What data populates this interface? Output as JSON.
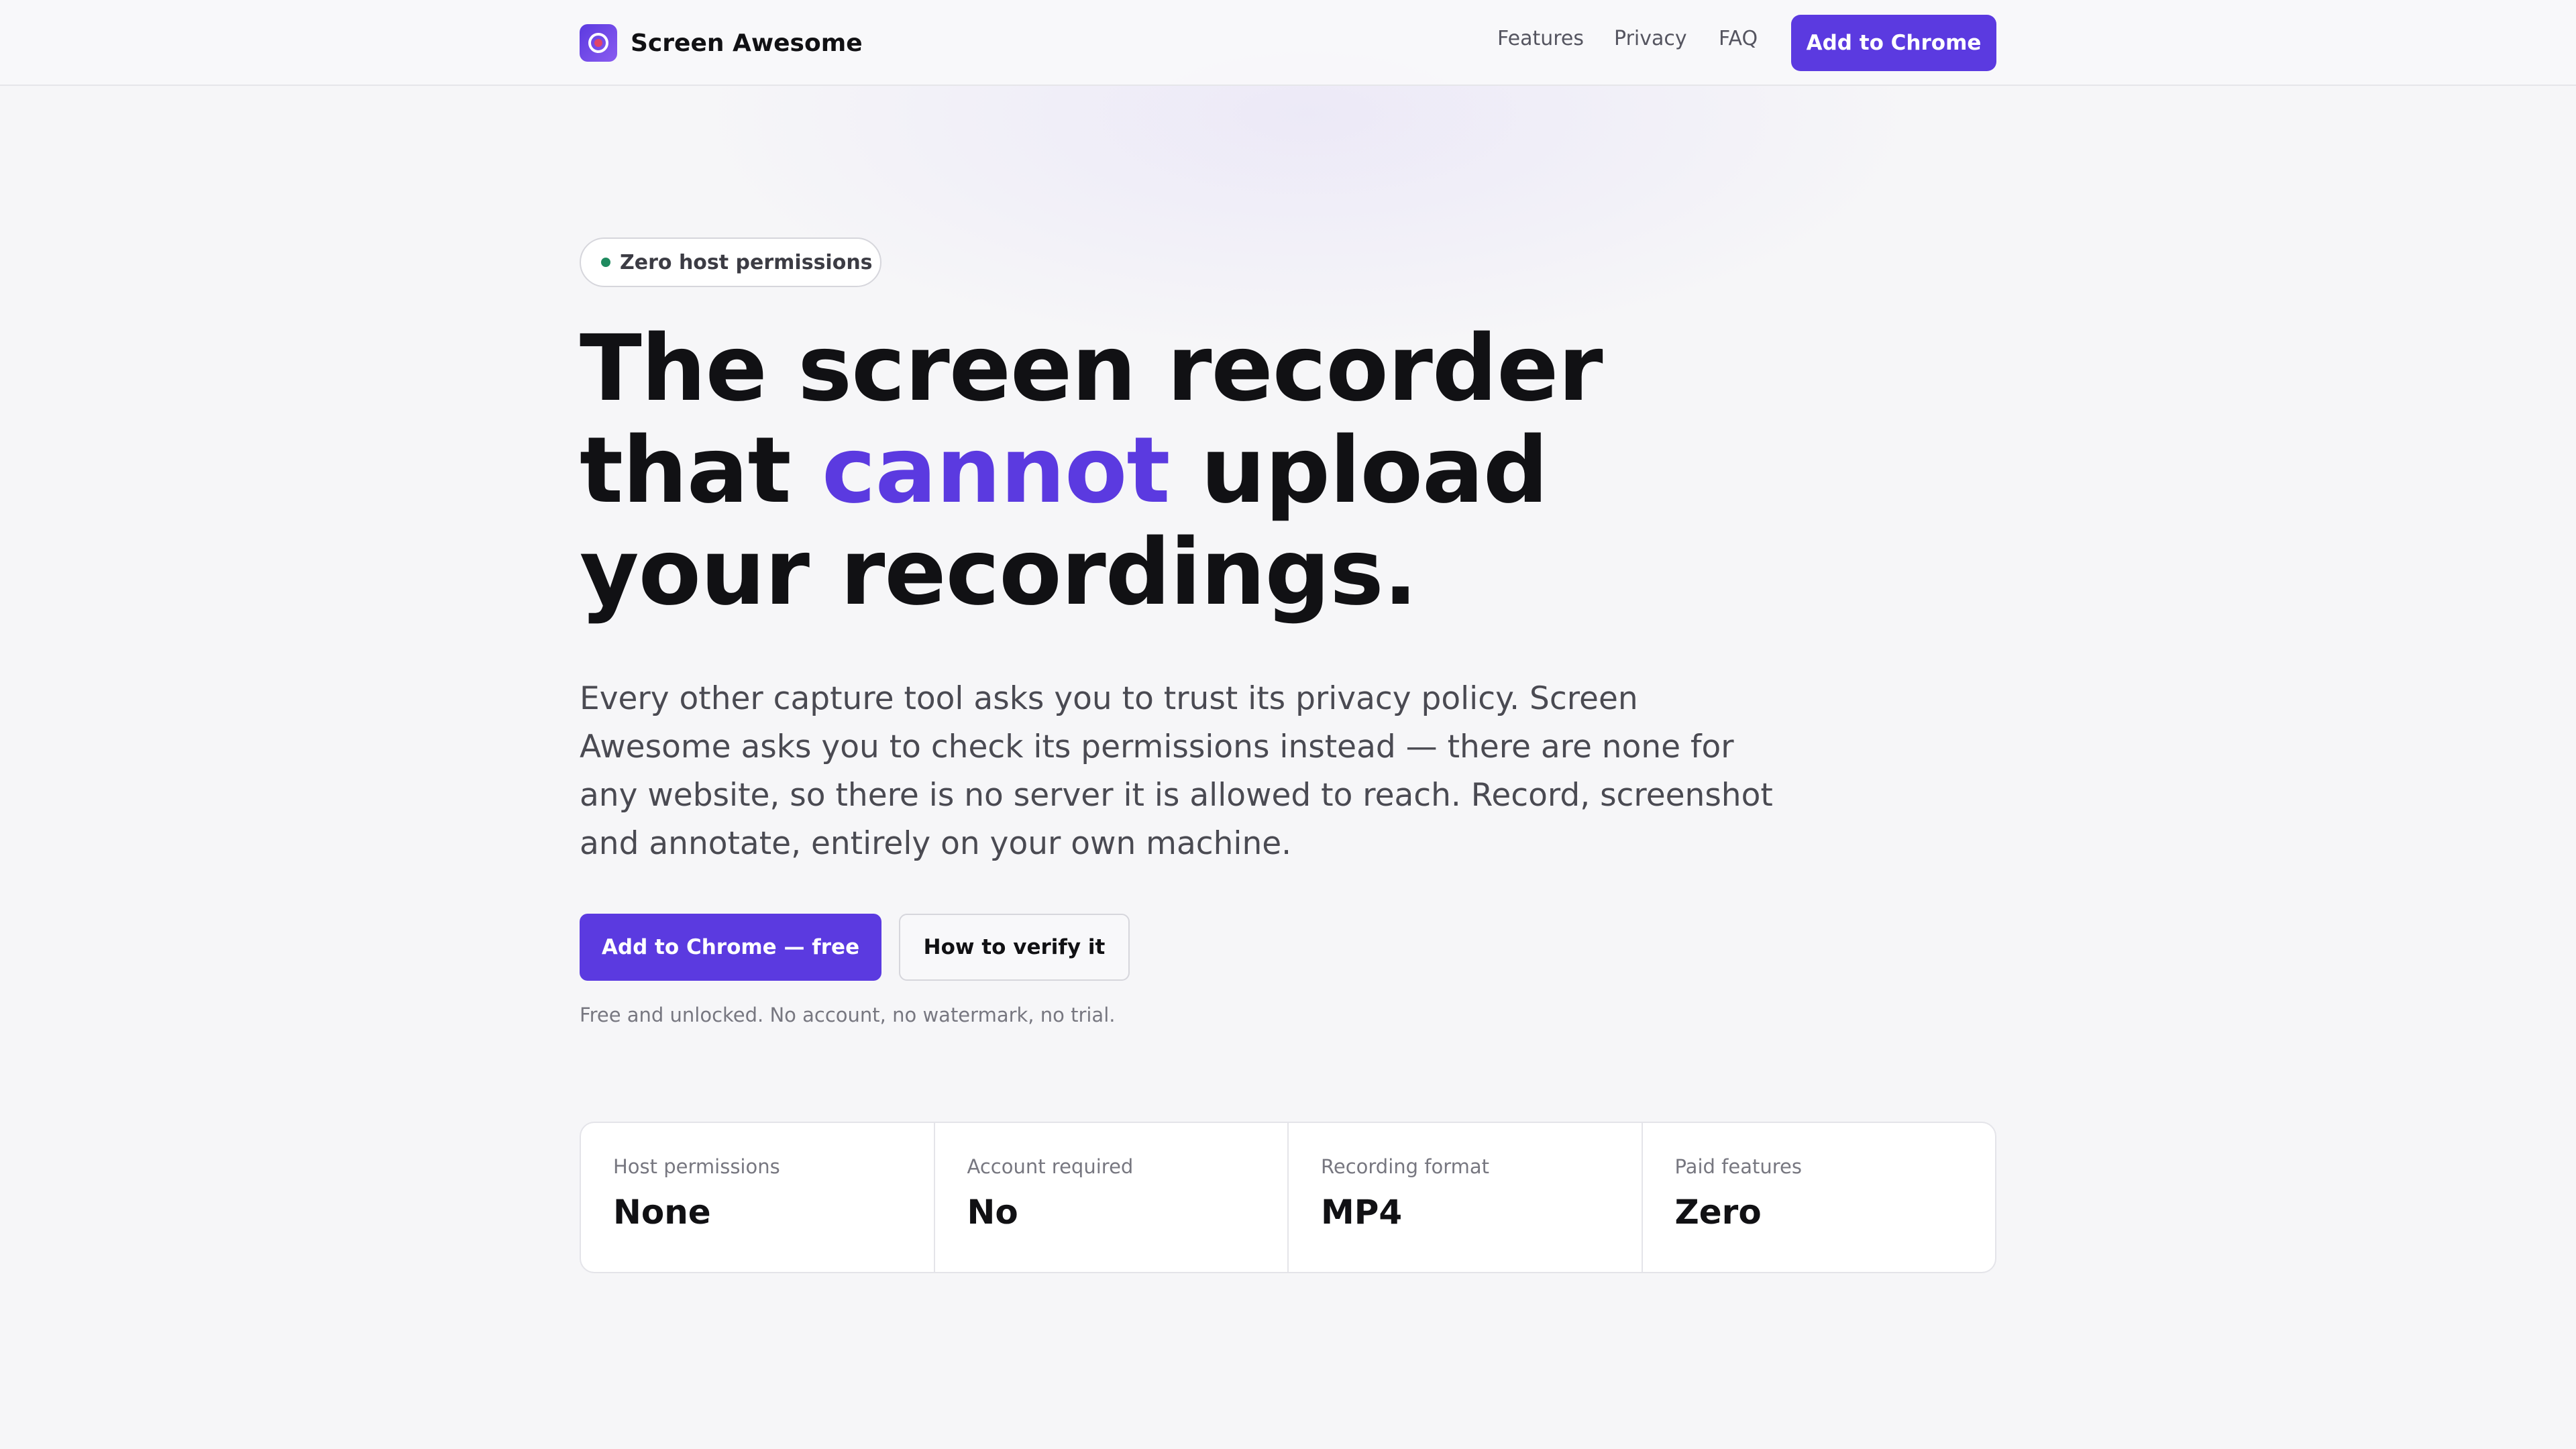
{
  "header": {
    "brand_name": "Screen Awesome",
    "nav": [
      "Features",
      "Privacy",
      "FAQ"
    ],
    "cta_label": "Add to Chrome"
  },
  "hero": {
    "badge": "Zero host permissions",
    "headline": {
      "line1": "The screen recorder",
      "line2_before": "that ",
      "line2_accent": "cannot",
      "line2_after": " upload",
      "line3": "your recordings."
    },
    "lede": "Every other capture tool asks you to trust its privacy policy. Screen Awesome asks you to check its permissions instead — there are none for any website, so there is no server it is allowed to reach. Record, screenshot and annotate, entirely on your own machine.",
    "primary_cta": "Add to Chrome — free",
    "secondary_cta": "How to verify it",
    "note": "Free and unlocked. No account, no watermark, no trial."
  },
  "stats": [
    {
      "label": "Host permissions",
      "value": "None"
    },
    {
      "label": "Account required",
      "value": "No"
    },
    {
      "label": "Recording format",
      "value": "MP4"
    },
    {
      "label": "Paid features",
      "value": "Zero"
    }
  ],
  "colors": {
    "accent": "#5b3ae0",
    "badge_dot": "#1f8a5f",
    "background": "#f6f6f8"
  },
  "icons": {
    "logo": "record-icon",
    "badge": "status-dot-icon"
  }
}
